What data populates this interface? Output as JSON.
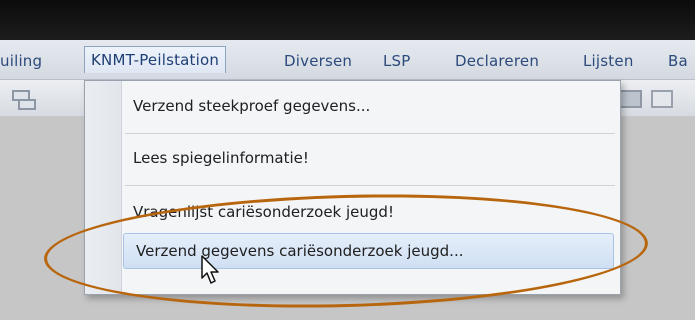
{
  "menubar": {
    "items": [
      {
        "label": "uiling"
      },
      {
        "label": "KNMT-Peilstation"
      },
      {
        "label": "Diversen"
      },
      {
        "label": "LSP"
      },
      {
        "label": "Declareren"
      },
      {
        "label": "Lijsten"
      },
      {
        "label": "Ba"
      }
    ]
  },
  "dropdown": {
    "items": [
      {
        "label": "Verzend steekproef gegevens..."
      },
      {
        "label": "Lees spiegelinformatie!"
      },
      {
        "label": "Vragenlijst cariësonderzoek jeugd!"
      },
      {
        "label": "Verzend gegevens cariësonderzoek jeugd..."
      }
    ]
  },
  "colors": {
    "annotation": "#b8660d",
    "menu_text": "#2c4a7b",
    "highlight": "#cfdff3"
  },
  "icons": [
    "toolbar-window-icon",
    "toolbar-display-icon",
    "toolbar-chart-icon",
    "mouse-cursor-icon"
  ]
}
